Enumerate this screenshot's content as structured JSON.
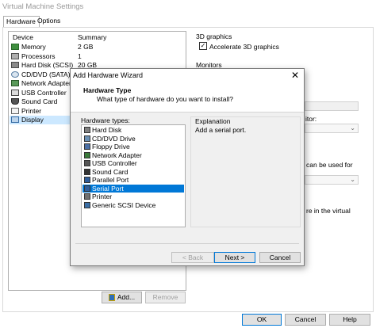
{
  "window": {
    "title": "Virtual Machine Settings"
  },
  "tabs": [
    {
      "label": "Hardware"
    },
    {
      "label": "Options"
    }
  ],
  "devices": {
    "col_device": "Device",
    "col_summary": "Summary",
    "rows": [
      {
        "name": "Memory",
        "summary": "2 GB",
        "icon": "memory-icon"
      },
      {
        "name": "Processors",
        "summary": "1",
        "icon": "processor-icon"
      },
      {
        "name": "Hard Disk (SCSI)",
        "summary": "20 GB",
        "icon": "hard-disk-icon"
      },
      {
        "name": "CD/DVD (SATA)",
        "summary": "",
        "icon": "cd-dvd-icon"
      },
      {
        "name": "Network Adapter",
        "summary": "",
        "icon": "network-adapter-icon"
      },
      {
        "name": "USB Controller",
        "summary": "",
        "icon": "usb-icon"
      },
      {
        "name": "Sound Card",
        "summary": "",
        "icon": "sound-card-icon"
      },
      {
        "name": "Printer",
        "summary": "",
        "icon": "printer-icon"
      },
      {
        "name": "Display",
        "summary": "",
        "icon": "display-icon"
      }
    ]
  },
  "device_buttons": {
    "add": "Add...",
    "remove": "Remove"
  },
  "right_panel": {
    "graphics_title": "3D graphics",
    "accelerate_label": "Accelerate 3D graphics",
    "monitors_title": "Monitors",
    "partial_monitor": "itor:",
    "partial_used_for": "can be used for",
    "partial_virtual": "re in the virtual"
  },
  "footer": {
    "ok": "OK",
    "cancel": "Cancel",
    "help": "Help"
  },
  "wizard": {
    "title": "Add Hardware Wizard",
    "header_title": "Hardware Type",
    "header_subtitle": "What type of hardware do you want to install?",
    "types_label": "Hardware types:",
    "types": [
      {
        "label": "Hard Disk",
        "icon": "hard-disk-icon",
        "color": "#808080"
      },
      {
        "label": "CD/DVD Drive",
        "icon": "cd-dvd-icon",
        "color": "#6a8fb3"
      },
      {
        "label": "Floppy Drive",
        "icon": "floppy-icon",
        "color": "#4a6fa5"
      },
      {
        "label": "Network Adapter",
        "icon": "network-adapter-icon",
        "color": "#3a7a3a"
      },
      {
        "label": "USB Controller",
        "icon": "usb-icon",
        "color": "#555555"
      },
      {
        "label": "Sound Card",
        "icon": "sound-card-icon",
        "color": "#333333"
      },
      {
        "label": "Parallel Port",
        "icon": "parallel-port-icon",
        "color": "#2f5d9a"
      },
      {
        "label": "Serial Port",
        "icon": "serial-port-icon",
        "color": "#2f5d9a"
      },
      {
        "label": "Printer",
        "icon": "printer-icon",
        "color": "#707070"
      },
      {
        "label": "Generic SCSI Device",
        "icon": "scsi-device-icon",
        "color": "#3a6ea5"
      }
    ],
    "selected_index": 7,
    "explanation_label": "Explanation",
    "explanation_text": "Add a serial port.",
    "back": "< Back",
    "next": "Next >",
    "cancel": "Cancel"
  },
  "colors": {
    "selection": "#0078d7",
    "selection_light": "#cce8ff",
    "accent_border": "#0078d7"
  }
}
